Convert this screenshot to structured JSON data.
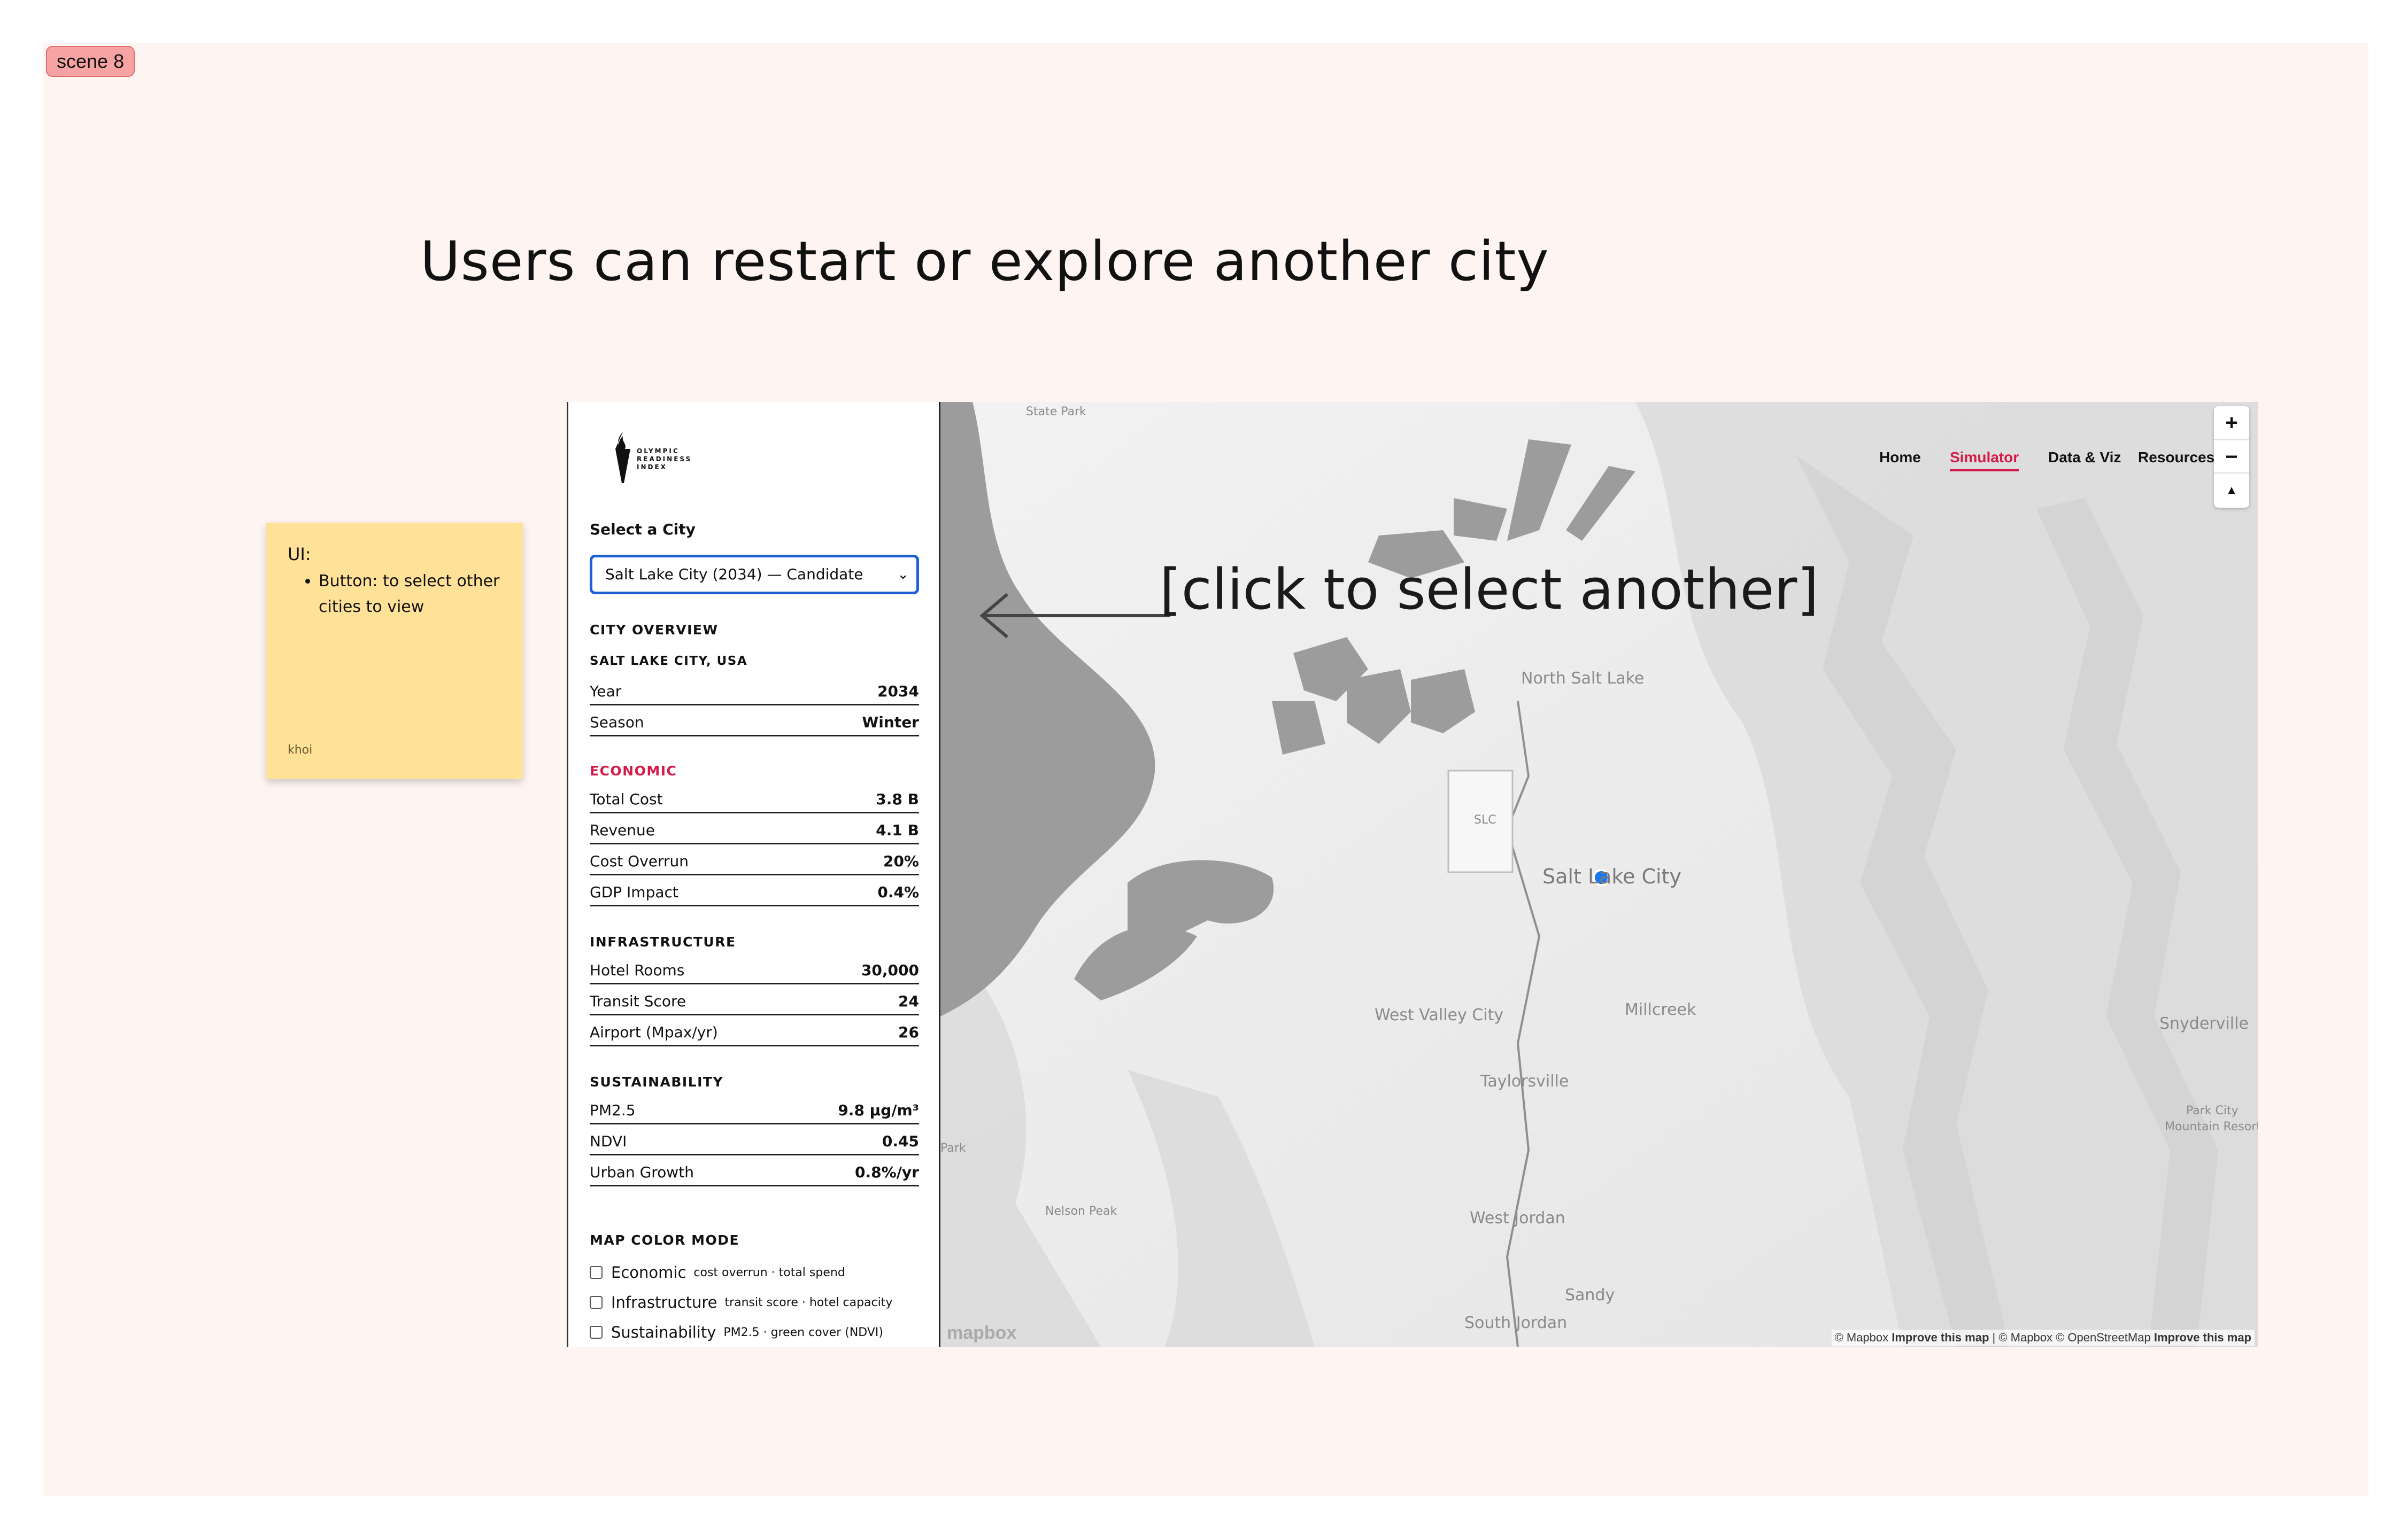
{
  "scene_tag": "scene 8",
  "headline": "Users can restart or explore another city",
  "sticky": {
    "title": "UI:",
    "bullet": "Button: to select other cities to view",
    "author": "khoi"
  },
  "logo": {
    "line1": "OLYMPIC",
    "line2": "READINESS",
    "line3": "INDEX"
  },
  "select_city": {
    "label": "Select a City",
    "value": "Salt Lake City (2034) — Candidate"
  },
  "overview": {
    "heading": "CITY OVERVIEW",
    "city": "SALT LAKE CITY, USA",
    "rows": [
      {
        "label": "Year",
        "value": "2034"
      },
      {
        "label": "Season",
        "value": "Winter"
      }
    ]
  },
  "economic": {
    "heading": "ECONOMIC",
    "rows": [
      {
        "label": "Total Cost",
        "value": "3.8 B"
      },
      {
        "label": "Revenue",
        "value": "4.1 B"
      },
      {
        "label": "Cost Overrun",
        "value": "20%"
      },
      {
        "label": "GDP Impact",
        "value": "0.4%"
      }
    ]
  },
  "infrastructure": {
    "heading": "INFRASTRUCTURE",
    "rows": [
      {
        "label": "Hotel Rooms",
        "value": "30,000"
      },
      {
        "label": "Transit Score",
        "value": "24"
      },
      {
        "label": "Airport (Mpax/yr)",
        "value": "26"
      }
    ]
  },
  "sustainability": {
    "heading": "SUSTAINABILITY",
    "rows": [
      {
        "label": "PM2.5",
        "value": "9.8 µg/m³"
      },
      {
        "label": "NDVI",
        "value": "0.45"
      },
      {
        "label": "Urban Growth",
        "value": "0.8%/yr"
      }
    ]
  },
  "map_color_mode": {
    "heading": "MAP COLOR MODE",
    "options": [
      {
        "label": "Economic",
        "desc": "cost overrun · total spend"
      },
      {
        "label": "Infrastructure",
        "desc": "transit score · hotel capacity"
      },
      {
        "label": "Sustainability",
        "desc": "PM2.5 · green cover (NDVI)"
      }
    ]
  },
  "nav": {
    "home": "Home",
    "simulator": "Simulator",
    "data_viz": "Data & Viz",
    "resources": "Resources"
  },
  "map": {
    "annotation": "[click to select another]",
    "places": {
      "state_park": "State Park",
      "north_salt_lake": "North Salt Lake",
      "slc": "SLC",
      "salt_lake_city": "Salt Lake City",
      "west_valley_city": "West Valley City",
      "millcreek": "Millcreek",
      "taylorsville": "Taylorsville",
      "snyderville": "Snyderville",
      "park_city": "Park City",
      "mountain_resort": "Mountain Resort",
      "nelson_peak": "Nelson Peak",
      "west_jordan": "West Jordan",
      "sandy": "Sandy",
      "south_jordan": "South Jordan",
      "park": "Park"
    },
    "attribution": {
      "mapbox1": "© Mapbox",
      "improve1": "Improve this map",
      "sep": "|",
      "mapbox2": "© Mapbox",
      "osm": "© OpenStreetMap",
      "improve2": "Improve this map"
    },
    "logo": "mapbox",
    "zoom_in": "+",
    "zoom_out": "−",
    "compass": "▲"
  }
}
